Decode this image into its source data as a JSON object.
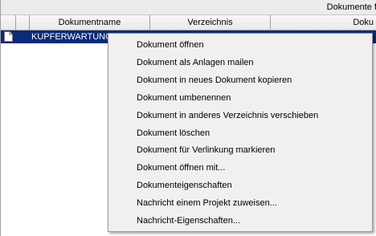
{
  "table": {
    "group_header": "Dokumente f",
    "columns": [
      "",
      "",
      "Dokumentname",
      "Verzeichnis",
      "Doku"
    ],
    "selected_row": {
      "icon": "document-icon",
      "name": "KUPFERWARTUNG"
    }
  },
  "context_menu": {
    "items": [
      "Dokument öffnen",
      "Dokument als Anlagen mailen",
      "Dokument in neues Dokument kopieren",
      "Dokument umbenennen",
      "Dokument in anderes Verzeichnis verschieben",
      "Dokument löschen",
      "Dokument für Verlinkung markieren",
      "Dokument öffnen mit...",
      "Dokumenteigenschaften",
      "Nachricht einem Projekt zuweisen...",
      "Nachricht-Eigenschaften..."
    ]
  },
  "colors": {
    "selection": "#0a2a7a",
    "menu_background": "#f0f0f0"
  }
}
